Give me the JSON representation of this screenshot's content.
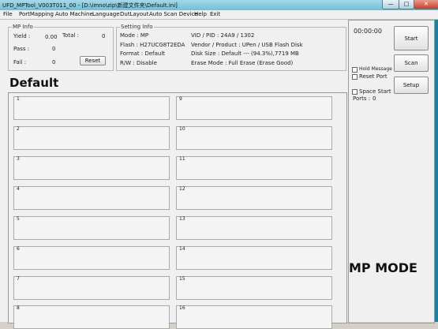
{
  "window": {
    "title": "UFD_MPTool_V003T011_00 - [D:\\imno\\zip\\新建文件夹\\Default.ini]",
    "min_glyph": "—",
    "max_glyph": "□",
    "close_glyph": "✕"
  },
  "menu": [
    "File",
    "PortMapping",
    "Auto Machine",
    "Language",
    "DutLayout",
    "Auto Scan Device",
    "Help",
    "Exit"
  ],
  "mp_info": {
    "legend": "MP Info",
    "yield_label": "Yield :",
    "yield_value": "0.00",
    "total_label": "Total :",
    "total_value": "0",
    "pass_label": "Pass :",
    "pass_value": "0",
    "fail_label": "Fail :",
    "fail_value": "0",
    "reset_label": "Reset"
  },
  "setting_info": {
    "legend": "Setting Info",
    "mode": "Mode : MP",
    "vid_pid": "VID / PID : 24A9 / 1302",
    "flash": "Flash : H27UCG8T2EDA",
    "vendor_product": "Vendor / Product : UPen / USB Flash Disk",
    "format": "Format : Default",
    "disk_size": "Disk Size : Default --- (94.3%),7719 MB",
    "rw": "R/W : Disable",
    "erase_mode": "Erase Mode : Full Erase (Erase Good)"
  },
  "overlay": {
    "default_label": "Default",
    "mp_mode_label": "MP MODE"
  },
  "ports": [
    "1",
    "2",
    "3",
    "4",
    "5",
    "6",
    "7",
    "8",
    "9",
    "10",
    "11",
    "12",
    "13",
    "14",
    "15",
    "16"
  ],
  "control": {
    "timer": "00:00:00",
    "start_label": "Start",
    "scan_label": "Scan",
    "setup_label": "Setup",
    "hold_message_label": "Hold Message",
    "reset_port_label": "Reset Port",
    "space_start_label": "Space Start",
    "ports_label": "Ports :",
    "ports_value": "0"
  }
}
